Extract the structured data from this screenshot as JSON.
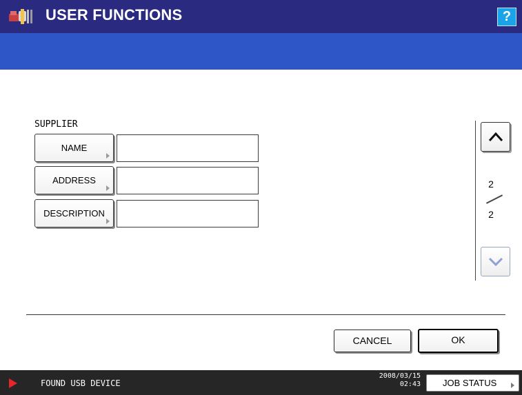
{
  "header": {
    "title": "USER FUNCTIONS",
    "help_label": "?",
    "icon": "user-functions-tools-icon"
  },
  "section": {
    "label": "SUPPLIER"
  },
  "fields": [
    {
      "button_label": "NAME",
      "value": ""
    },
    {
      "button_label": "ADDRESS",
      "value": ""
    },
    {
      "button_label": "DESCRIPTION",
      "value": ""
    }
  ],
  "pager": {
    "current_page": "2",
    "total_pages": "2",
    "up_icon": "chevron-up-icon",
    "down_icon": "chevron-down-icon"
  },
  "actions": {
    "cancel_label": "CANCEL",
    "ok_label": "OK"
  },
  "statusbar": {
    "message": "FOUND USB DEVICE",
    "date": "2008/03/15",
    "time": "02:43",
    "job_status_label": "JOB STATUS"
  },
  "colors": {
    "title_bar": "#2a2a80",
    "sub_bar": "#2e56c6",
    "help_button": "#1aa3e8",
    "status_bar": "#262626",
    "alert_triangle": "#e8262a"
  }
}
